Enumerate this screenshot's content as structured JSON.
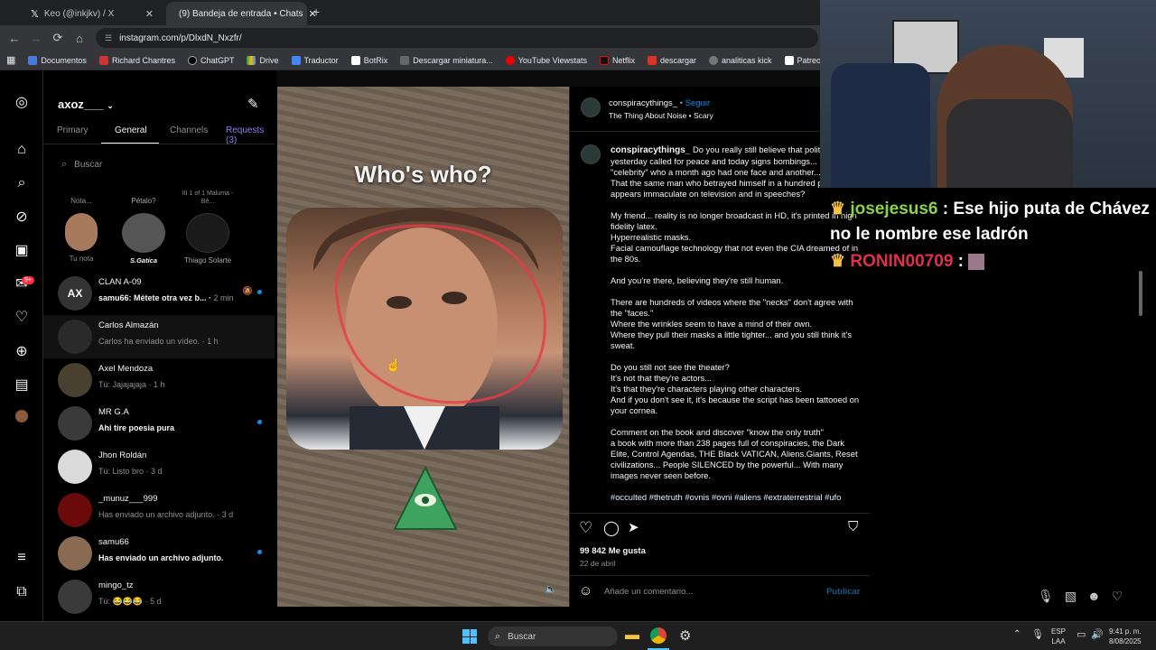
{
  "browser": {
    "tabs": [
      {
        "label": "Keo (@inkjkv) / X"
      },
      {
        "label": "(9) Bandeja de entrada • Chats"
      }
    ],
    "new_tab": "+",
    "url": "instagram.com/p/DlxdN_Nxzfr/",
    "bookmarks": [
      "Documentos",
      "Richard Chantres",
      "ChatGPT",
      "Drive",
      "Traductor",
      "BotRix",
      "Descargar miniatura...",
      "YouTube Viewstats",
      "Netflix",
      "descargar",
      "analiticas kick",
      "Patreon"
    ]
  },
  "inbox": {
    "username": "axoz___",
    "tabs": [
      "Primary",
      "General",
      "Channels",
      "Requests (3)"
    ],
    "search_placeholder": "Buscar",
    "notes": [
      {
        "label": "Tu nota",
        "bubble": "Nota..."
      },
      {
        "label": "S.Gatica",
        "bubble": "Pétalo?"
      },
      {
        "label": "Thiago Solarte",
        "bubble": "III 1 of 1  Maluma - Bé..."
      }
    ],
    "chats": [
      {
        "name": "CLAN A-09",
        "sub": "samu66: Métete otra vez b...",
        "time": "2 min",
        "bold": true
      },
      {
        "name": "Carlos Almazán",
        "sub": "Carlos ha enviado un vídeo.",
        "time": "1 h",
        "bold": false
      },
      {
        "name": "Axel Mendoza",
        "sub": "Tú: Jajajajaja",
        "time": "1 h",
        "bold": false
      },
      {
        "name": "MR G.A",
        "sub": "Ahi tire poesia pura",
        "time": "",
        "bold": true
      },
      {
        "name": "Jhon Roldán",
        "sub": "Tú: Listo bro",
        "time": "3 d",
        "bold": false
      },
      {
        "name": "_munuz___999",
        "sub": "Has enviado un archivo adjunto.",
        "time": "3 d",
        "bold": false
      },
      {
        "name": "samu66",
        "sub": "Has enviado un archivo adjunto.",
        "time": "",
        "bold": true
      },
      {
        "name": "mingo_tz",
        "sub": "Tú: 😂😂😂",
        "time": "5 d",
        "bold": false
      }
    ],
    "notif_badge": "9+"
  },
  "post": {
    "overlay_title": "Who's who?",
    "author": "conspiracythings_",
    "follow": "Seguir",
    "audio": "The Thing About Noise • Scary",
    "caption_author": "conspiracythings_",
    "caption_paragraphs": [
      "Do you really still believe that politicians who yesterday called for peace and today signs bombings... is That that \"celebrity\" who a month ago had one face and another... is her?",
      "That the same man who betrayed himself in a hundred plots now appears immaculate on television and in speeches?",
      "My friend... reality is no longer broadcast in HD, it's printed in high fidelity latex.\nHyperrealistic masks.\nFacial camouflage technology that not even the CIA dreamed of in the 80s.",
      "And you're there, believing they're still human.",
      "There are hundreds of videos where the \"necks\" don't agree with the \"faces.\"\nWhere the wrinkles seem to have a mind of their own.\nWhere they pull their masks a little tighter... and you still think it's sweat.",
      "Do you still not see the theater?\nIt's not that they're actors...\nIt's that they're characters playing other characters.\nAnd if you don't see it, it's because the script has been tattooed on your cornea.",
      "Comment on the book and discover \"know the only truth\"\na book with more than 238 pages full of conspiracies, the Dark Elite, Control Agendas, THE Black VATICAN, Aliens.Giants, Reset civilizations... People SILENCED by the powerful... With many images never seen before."
    ],
    "hashtags": "#occulted #thetruth #ovnis #ovni #aliens #extraterrestrial #ufo",
    "likes": "99 842 Me gusta",
    "date": "22 de abril",
    "comment_placeholder": "Añade un comentario...",
    "publish": "Publicar"
  },
  "stream_chat": [
    {
      "user": "josejesus6",
      "sep": ":",
      "msg": "Ese hijo puta de Chávez no le nombre ese ladrón",
      "color": "#8ad24a"
    },
    {
      "user": "RONIN00709",
      "sep": ":",
      "msg": "",
      "color": "#e0304a"
    }
  ],
  "taskbar": {
    "search": "Buscar",
    "lang": "ESP",
    "lang2": "LAA",
    "time": "9:41 p. m.",
    "date": "8/08/2025"
  }
}
